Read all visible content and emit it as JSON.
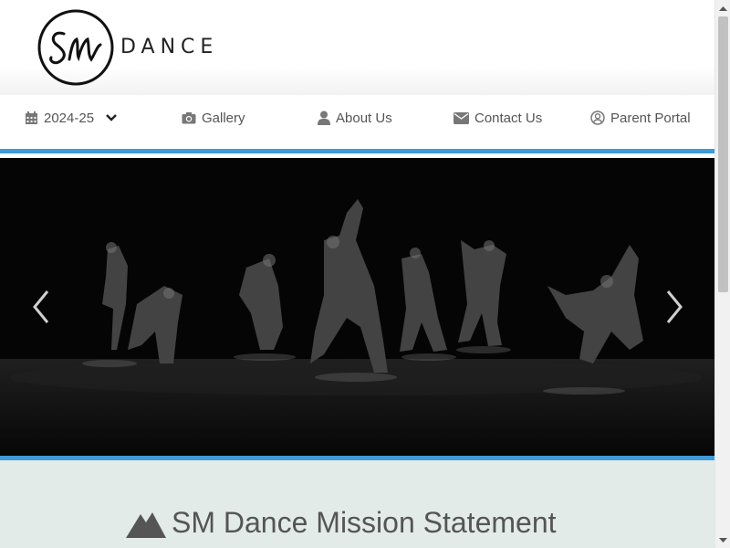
{
  "logo": {
    "monogram": "SM",
    "word": "DANCE"
  },
  "nav": {
    "items": [
      {
        "icon": "calendar-icon",
        "label": "2024-25",
        "has_dropdown": true
      },
      {
        "icon": "camera-icon",
        "label": "Gallery"
      },
      {
        "icon": "user-icon",
        "label": "About Us"
      },
      {
        "icon": "envelope-icon",
        "label": "Contact Us"
      },
      {
        "icon": "user-circle-icon",
        "label": "Parent Portal"
      }
    ]
  },
  "hero": {
    "prev_icon": "chevron-left-icon",
    "next_icon": "chevron-right-icon"
  },
  "mission": {
    "icon": "mountain-icon",
    "title": "SM Dance Mission Statement"
  },
  "colors": {
    "accent": "#3d9bd6",
    "section_bg": "#e3ebe9",
    "nav_text": "#555555"
  }
}
